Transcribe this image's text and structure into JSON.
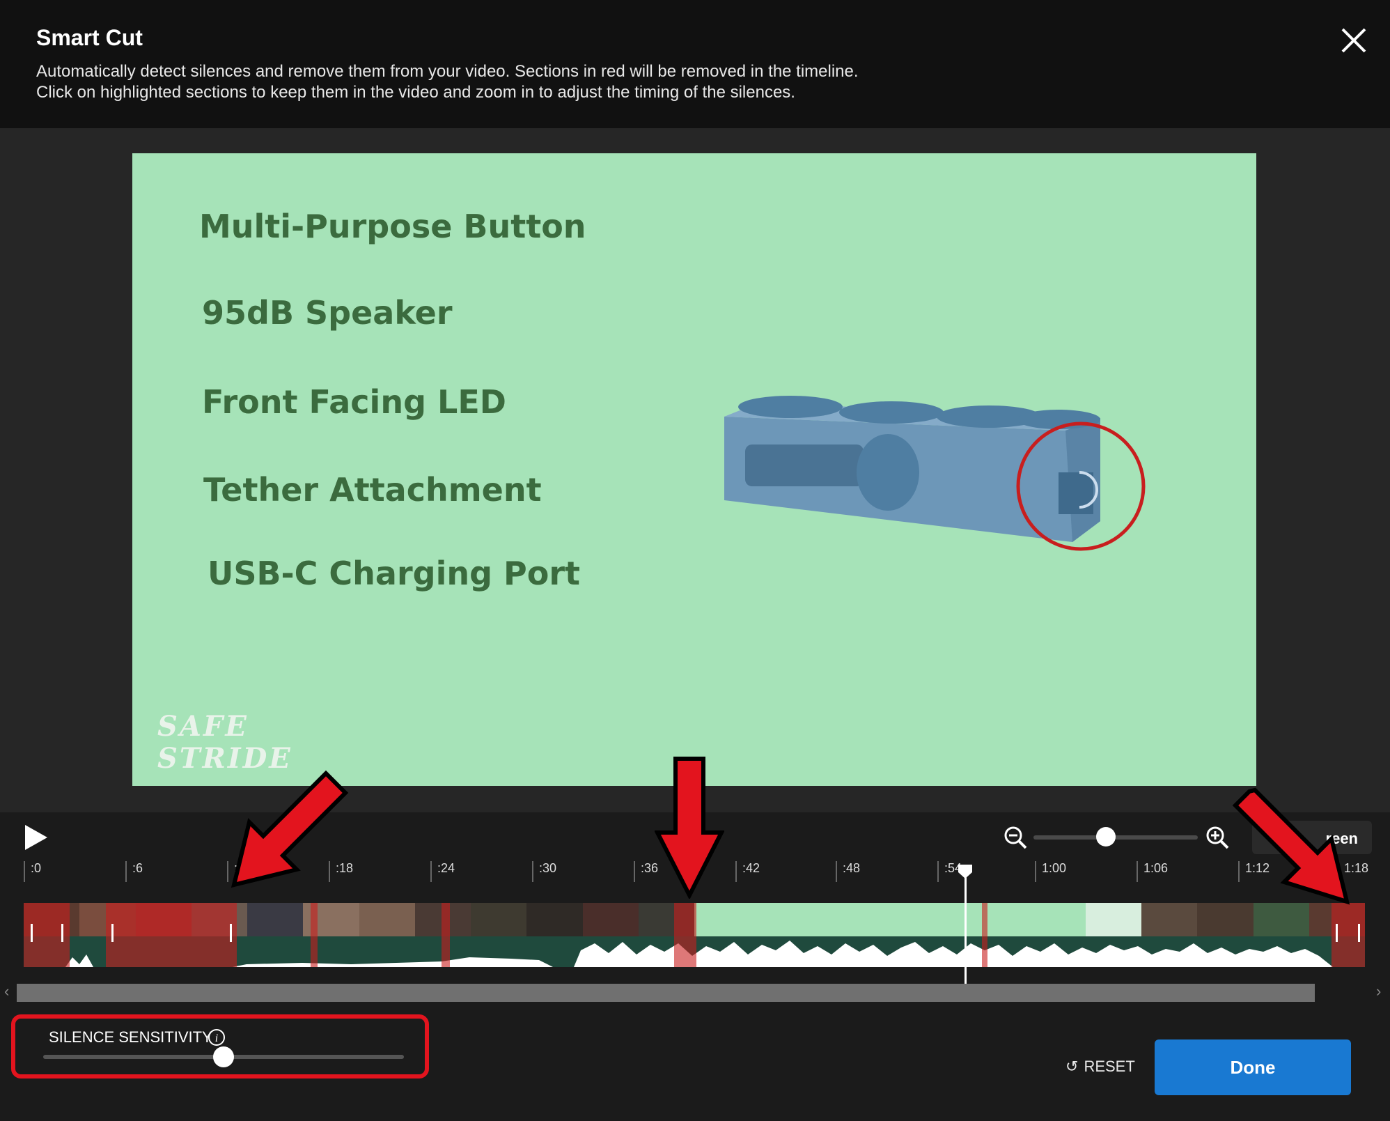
{
  "dialog": {
    "title": "Smart Cut",
    "description_line1": "Automatically detect silences and remove them from your video. Sections in red will be removed in the timeline.",
    "description_line2": "Click on highlighted sections to keep them in the video and zoom in to adjust the timing of the silences."
  },
  "video": {
    "features": [
      "Multi-Purpose Button",
      "95dB Speaker",
      "Front Facing LED",
      "Tether Attachment",
      "USB-C Charging Port"
    ],
    "brand_line1": "SAFE",
    "brand_line2": "STRIDE",
    "background_color": "#a6e3b8"
  },
  "timeline": {
    "ticks": [
      ":0",
      ":6",
      ":12",
      ":18",
      ":24",
      ":30",
      ":36",
      ":42",
      ":48",
      ":54",
      "1:00",
      "1:06",
      "1:12",
      "1:18"
    ],
    "playhead_time_seconds": 56.3,
    "zoom_level_fraction": 0.38,
    "fullscreen_button_label": "reen",
    "silence_color": "#c81e1e"
  },
  "sensitivity": {
    "label": "SILENCE SENSITIVITY",
    "value_fraction": 0.5
  },
  "actions": {
    "reset_label": "RESET",
    "done_label": "Done",
    "done_color": "#1979d2"
  },
  "icons": [
    "close-icon",
    "play-icon",
    "zoom-out-icon",
    "zoom-in-icon",
    "info-icon",
    "reset-icon"
  ]
}
